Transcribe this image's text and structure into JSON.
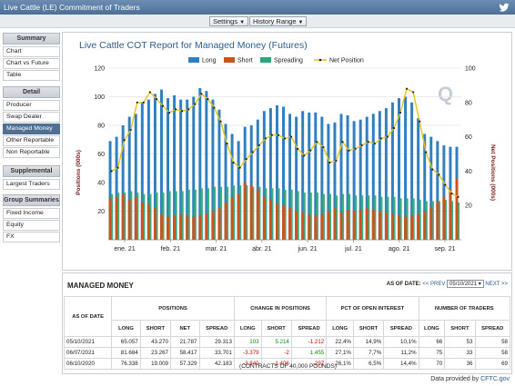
{
  "window": {
    "title": "Live Cattle (LE) Commitment of Traders",
    "twitter_icon": "twitter-bird-icon"
  },
  "menubar": {
    "settings_label": "Settings",
    "history_label": "History Range"
  },
  "sidebar": {
    "sections": [
      {
        "label": "Summary",
        "items": [
          "Chart",
          "Chart vs Future",
          "Table"
        ]
      },
      {
        "label": "Detail",
        "items": [
          "Producer",
          "Swap Dealer",
          "Managed Money",
          "Other Reportable",
          "Non Reportable"
        ]
      },
      {
        "label": "Supplemental",
        "items": [
          "Largest Traders"
        ]
      },
      {
        "label": "Group Summaries",
        "items": [
          "Fixed Income",
          "Equity",
          "FX"
        ]
      }
    ],
    "active_item": "Managed Money"
  },
  "colors": {
    "long": "#2f7fc1",
    "short": "#c8551d",
    "spreading": "#2ca47c",
    "net": "#e8c21a",
    "net_marker": "#222222",
    "accent": "#2c5d8f"
  },
  "chart_data": {
    "type": "bar",
    "title": "Live Cattle COT Report for Managed Money (Futures)",
    "ylabel_left": "Positions (000s)",
    "ylabel_right": "Net Positions (000s)",
    "ylim_left": [
      0,
      120
    ],
    "ylim_right": [
      0,
      100
    ],
    "yticks_left": [
      20,
      40,
      60,
      80,
      100,
      120
    ],
    "yticks_right": [
      20,
      40,
      60,
      80,
      100
    ],
    "xticks": [
      "ene. 21",
      "feb. 21",
      "mar. 21",
      "abr. 21",
      "jun. 21",
      "jul. 21",
      "ago. 21",
      "sep. 21"
    ],
    "legend": [
      "Long",
      "Short",
      "Spreading",
      "Net Position"
    ],
    "legend_position": "top",
    "watermark": "Q",
    "series": [
      {
        "name": "Long",
        "values": [
          69,
          72,
          80,
          86,
          88,
          96,
          98,
          102,
          105,
          99,
          101,
          98,
          98,
          100,
          106,
          104,
          98,
          91,
          81,
          74,
          69,
          79,
          80,
          84,
          90,
          92,
          94,
          93,
          88,
          86,
          90,
          89,
          89,
          86,
          81,
          82,
          88,
          87,
          83,
          84,
          86,
          88,
          90,
          92,
          96,
          99,
          100,
          96,
          85,
          74,
          72,
          69,
          66,
          65,
          65
        ]
      },
      {
        "name": "Short",
        "values": [
          29,
          30,
          32,
          28,
          30,
          26,
          25,
          22,
          18,
          16,
          17,
          18,
          17,
          16,
          17,
          18,
          20,
          22,
          26,
          30,
          32,
          40,
          38,
          35,
          30,
          28,
          25,
          24,
          22,
          20,
          19,
          18,
          17,
          18,
          20,
          22,
          19,
          21,
          20,
          21,
          22,
          21,
          20,
          19,
          18,
          17,
          16,
          17,
          18,
          20,
          23,
          27,
          30,
          35,
          43
        ]
      },
      {
        "name": "Spreading",
        "values": [
          32,
          33,
          33,
          34,
          33,
          32,
          32,
          33,
          33,
          34,
          34,
          34,
          35,
          35,
          36,
          36,
          37,
          37,
          37,
          38,
          38,
          38,
          37,
          37,
          36,
          36,
          36,
          35,
          35,
          34,
          33,
          33,
          33,
          32,
          32,
          31,
          32,
          32,
          31,
          31,
          31,
          31,
          30,
          30,
          30,
          29,
          29,
          29,
          28,
          27,
          27,
          27,
          28,
          27,
          26
        ]
      },
      {
        "name": "Net Position",
        "values": [
          40,
          42,
          58,
          64,
          80,
          80,
          86,
          82,
          78,
          74,
          76,
          75,
          76,
          79,
          85,
          82,
          77,
          69,
          56,
          45,
          42,
          47,
          51,
          55,
          59,
          61,
          61,
          59,
          60,
          53,
          49,
          52,
          57,
          54,
          45,
          46,
          57,
          52,
          53,
          55,
          57,
          56,
          59,
          60,
          65,
          74,
          88,
          86,
          69,
          51,
          41,
          38,
          32,
          27,
          25
        ]
      }
    ]
  },
  "table": {
    "title": "MANAGED MONEY",
    "as_of_label": "AS OF DATE:",
    "prev_label": "<< PREV",
    "next_label": "NEXT >>",
    "selected_date": "05/10/2021",
    "group_headers": {
      "as_of_date": "AS OF DATE",
      "positions": "POSITIONS",
      "change": "CHANGE IN POSITIONS",
      "pct": "PCT OF OPEN INTEREST",
      "traders": "NUMBER OF TRADERS"
    },
    "sub_headers": {
      "long": "LONG",
      "short": "SHORT",
      "net": "NET",
      "spread": "SPREAD",
      "c_long": "LONG",
      "c_short": "SHORT",
      "c_spread": "SPREAD",
      "p_long": "LONG",
      "p_short": "SHORT",
      "p_spread": "SPREAD",
      "t_long": "LONG",
      "t_short": "SHORT",
      "t_spread": "SPREAD"
    },
    "rows": [
      {
        "date": "05/10/2021",
        "long": "65.057",
        "short": "43.270",
        "net": "21.787",
        "spread": "29.313",
        "c_long": "103",
        "c_short": "5.214",
        "c_spread": "-1.212",
        "p_long": "22,4%",
        "p_short": "14,9%",
        "p_spread": "10,1%",
        "t_long": "66",
        "t_short": "53",
        "t_spread": "58"
      },
      {
        "date": "06/07/2021",
        "long": "81.684",
        "short": "23.267",
        "net": "58.417",
        "spread": "33.701",
        "c_long": "-3.379",
        "c_short": "-2",
        "c_spread": "1.455",
        "p_long": "27,1%",
        "p_short": "7,7%",
        "p_spread": "11,2%",
        "t_long": "75",
        "t_short": "33",
        "t_spread": "58"
      },
      {
        "date": "06/10/2020",
        "long": "76.338",
        "short": "19.009",
        "net": "57.329",
        "spread": "42.183",
        "c_long": "-3.840",
        "c_short": "-1.406",
        "c_spread": "-297",
        "p_long": "26,1%",
        "p_short": "6,5%",
        "p_spread": "14,4%",
        "t_long": "70",
        "t_short": "36",
        "t_spread": "69"
      }
    ],
    "footer": "(CONTRACTS OF 40,000 POUNDS)"
  },
  "provided_by": {
    "label": "Data provided by",
    "source": "CFTC.gov"
  }
}
